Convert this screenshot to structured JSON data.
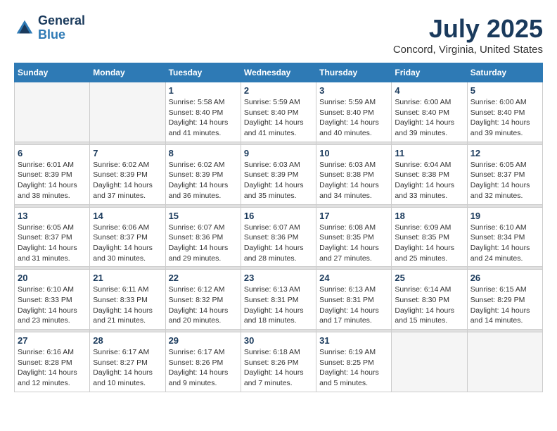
{
  "header": {
    "logo_general": "General",
    "logo_blue": "Blue",
    "title": "July 2025",
    "location": "Concord, Virginia, United States"
  },
  "weekdays": [
    "Sunday",
    "Monday",
    "Tuesday",
    "Wednesday",
    "Thursday",
    "Friday",
    "Saturday"
  ],
  "weeks": [
    [
      {
        "day": "",
        "info": ""
      },
      {
        "day": "",
        "info": ""
      },
      {
        "day": "1",
        "info": "Sunrise: 5:58 AM\nSunset: 8:40 PM\nDaylight: 14 hours and 41 minutes."
      },
      {
        "day": "2",
        "info": "Sunrise: 5:59 AM\nSunset: 8:40 PM\nDaylight: 14 hours and 41 minutes."
      },
      {
        "day": "3",
        "info": "Sunrise: 5:59 AM\nSunset: 8:40 PM\nDaylight: 14 hours and 40 minutes."
      },
      {
        "day": "4",
        "info": "Sunrise: 6:00 AM\nSunset: 8:40 PM\nDaylight: 14 hours and 39 minutes."
      },
      {
        "day": "5",
        "info": "Sunrise: 6:00 AM\nSunset: 8:40 PM\nDaylight: 14 hours and 39 minutes."
      }
    ],
    [
      {
        "day": "6",
        "info": "Sunrise: 6:01 AM\nSunset: 8:39 PM\nDaylight: 14 hours and 38 minutes."
      },
      {
        "day": "7",
        "info": "Sunrise: 6:02 AM\nSunset: 8:39 PM\nDaylight: 14 hours and 37 minutes."
      },
      {
        "day": "8",
        "info": "Sunrise: 6:02 AM\nSunset: 8:39 PM\nDaylight: 14 hours and 36 minutes."
      },
      {
        "day": "9",
        "info": "Sunrise: 6:03 AM\nSunset: 8:39 PM\nDaylight: 14 hours and 35 minutes."
      },
      {
        "day": "10",
        "info": "Sunrise: 6:03 AM\nSunset: 8:38 PM\nDaylight: 14 hours and 34 minutes."
      },
      {
        "day": "11",
        "info": "Sunrise: 6:04 AM\nSunset: 8:38 PM\nDaylight: 14 hours and 33 minutes."
      },
      {
        "day": "12",
        "info": "Sunrise: 6:05 AM\nSunset: 8:37 PM\nDaylight: 14 hours and 32 minutes."
      }
    ],
    [
      {
        "day": "13",
        "info": "Sunrise: 6:05 AM\nSunset: 8:37 PM\nDaylight: 14 hours and 31 minutes."
      },
      {
        "day": "14",
        "info": "Sunrise: 6:06 AM\nSunset: 8:37 PM\nDaylight: 14 hours and 30 minutes."
      },
      {
        "day": "15",
        "info": "Sunrise: 6:07 AM\nSunset: 8:36 PM\nDaylight: 14 hours and 29 minutes."
      },
      {
        "day": "16",
        "info": "Sunrise: 6:07 AM\nSunset: 8:36 PM\nDaylight: 14 hours and 28 minutes."
      },
      {
        "day": "17",
        "info": "Sunrise: 6:08 AM\nSunset: 8:35 PM\nDaylight: 14 hours and 27 minutes."
      },
      {
        "day": "18",
        "info": "Sunrise: 6:09 AM\nSunset: 8:35 PM\nDaylight: 14 hours and 25 minutes."
      },
      {
        "day": "19",
        "info": "Sunrise: 6:10 AM\nSunset: 8:34 PM\nDaylight: 14 hours and 24 minutes."
      }
    ],
    [
      {
        "day": "20",
        "info": "Sunrise: 6:10 AM\nSunset: 8:33 PM\nDaylight: 14 hours and 23 minutes."
      },
      {
        "day": "21",
        "info": "Sunrise: 6:11 AM\nSunset: 8:33 PM\nDaylight: 14 hours and 21 minutes."
      },
      {
        "day": "22",
        "info": "Sunrise: 6:12 AM\nSunset: 8:32 PM\nDaylight: 14 hours and 20 minutes."
      },
      {
        "day": "23",
        "info": "Sunrise: 6:13 AM\nSunset: 8:31 PM\nDaylight: 14 hours and 18 minutes."
      },
      {
        "day": "24",
        "info": "Sunrise: 6:13 AM\nSunset: 8:31 PM\nDaylight: 14 hours and 17 minutes."
      },
      {
        "day": "25",
        "info": "Sunrise: 6:14 AM\nSunset: 8:30 PM\nDaylight: 14 hours and 15 minutes."
      },
      {
        "day": "26",
        "info": "Sunrise: 6:15 AM\nSunset: 8:29 PM\nDaylight: 14 hours and 14 minutes."
      }
    ],
    [
      {
        "day": "27",
        "info": "Sunrise: 6:16 AM\nSunset: 8:28 PM\nDaylight: 14 hours and 12 minutes."
      },
      {
        "day": "28",
        "info": "Sunrise: 6:17 AM\nSunset: 8:27 PM\nDaylight: 14 hours and 10 minutes."
      },
      {
        "day": "29",
        "info": "Sunrise: 6:17 AM\nSunset: 8:26 PM\nDaylight: 14 hours and 9 minutes."
      },
      {
        "day": "30",
        "info": "Sunrise: 6:18 AM\nSunset: 8:26 PM\nDaylight: 14 hours and 7 minutes."
      },
      {
        "day": "31",
        "info": "Sunrise: 6:19 AM\nSunset: 8:25 PM\nDaylight: 14 hours and 5 minutes."
      },
      {
        "day": "",
        "info": ""
      },
      {
        "day": "",
        "info": ""
      }
    ]
  ]
}
